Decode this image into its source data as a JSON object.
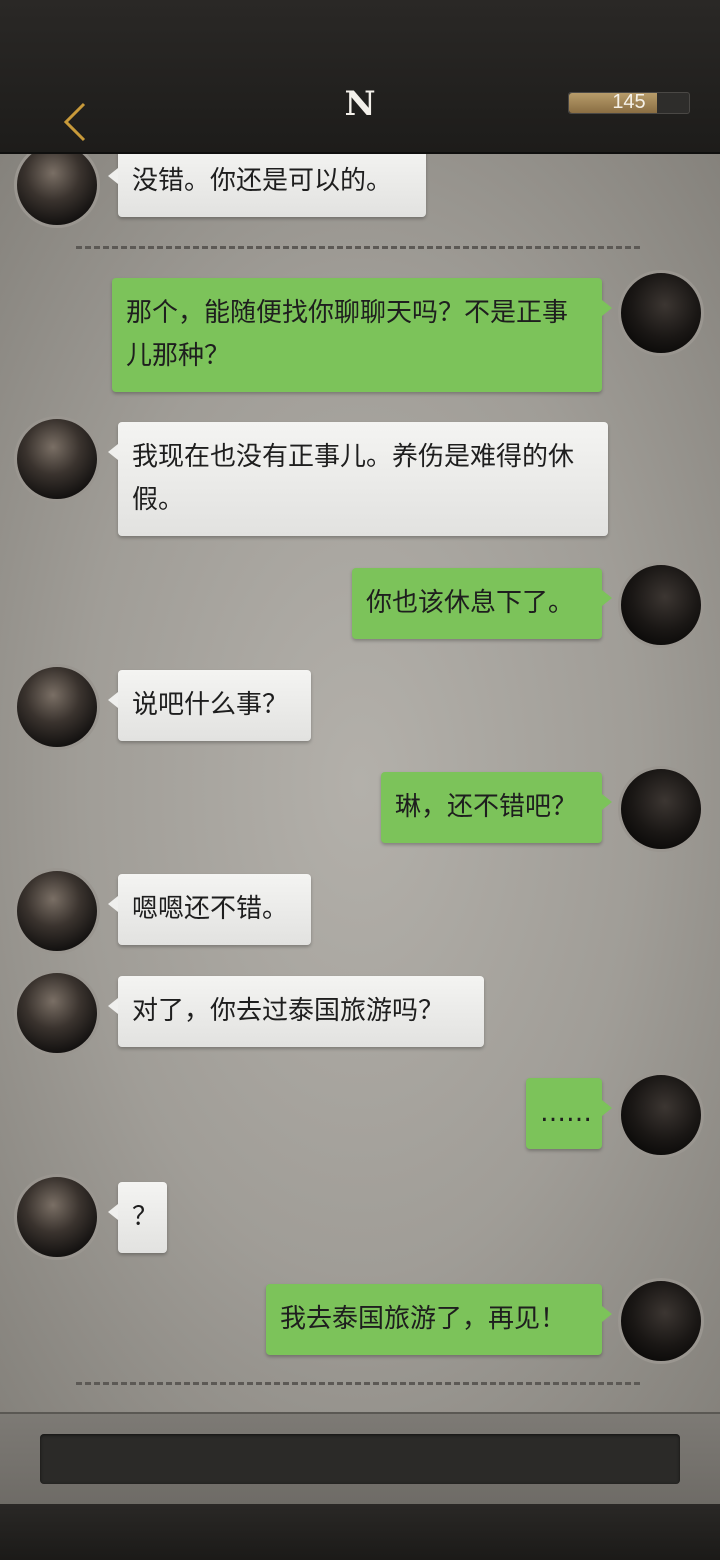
{
  "header": {
    "title": "N",
    "counter_value": "145",
    "counter_fill_fraction": 0.73
  },
  "messages": [
    {
      "side": "left",
      "text": "没错。你还是可以的。"
    },
    {
      "side": "right",
      "text": "那个，能随便找你聊聊天吗？不是正事儿那种？"
    },
    {
      "side": "left",
      "text": "我现在也没有正事儿。养伤是难得的休假。"
    },
    {
      "side": "right",
      "text": "你也该休息下了。"
    },
    {
      "side": "left",
      "text": "说吧什么事？"
    },
    {
      "side": "right",
      "text": "琳，还不错吧？"
    },
    {
      "side": "left",
      "text": "嗯嗯还不错。"
    },
    {
      "side": "left",
      "text": "对了，你去过泰国旅游吗？"
    },
    {
      "side": "right",
      "text": "……"
    },
    {
      "side": "left",
      "text": "？"
    },
    {
      "side": "right",
      "text": "我去泰国旅游了，再见！"
    }
  ],
  "input": {
    "placeholder": ""
  },
  "colors": {
    "left_bubble": "#efefed",
    "right_bubble": "#7cc35a",
    "header_bg": "#1d1c1a",
    "counter_fill": "#b79c6a"
  }
}
